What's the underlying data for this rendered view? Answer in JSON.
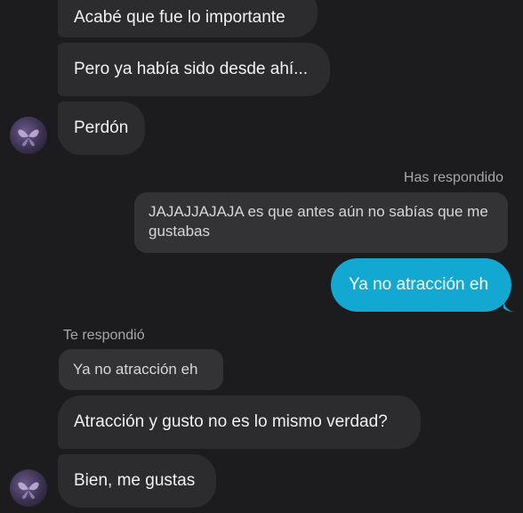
{
  "messages": {
    "msg1": "Acabé que fue lo importante",
    "msg2": "Pero ya había sido desde ahí...",
    "msg3": "Perdón",
    "reply_label_self": "Has respondido",
    "quoted_self": "JAJAJJAJAJA es que antes aún no sabías que me gustabas",
    "outgoing": "Ya no atracción eh",
    "reply_label_other": "Te respondió",
    "quoted_other": "Ya no atracción eh",
    "msg4": "Atracción y gusto no es lo mismo verdad?",
    "msg5": "Bien, me gustas"
  },
  "icons": {
    "avatar": "butterfly-avatar-icon"
  },
  "colors": {
    "background": "#1c1c1e",
    "incoming_bubble": "#2c2c2e",
    "outgoing_bubble": "#13a8d1"
  }
}
